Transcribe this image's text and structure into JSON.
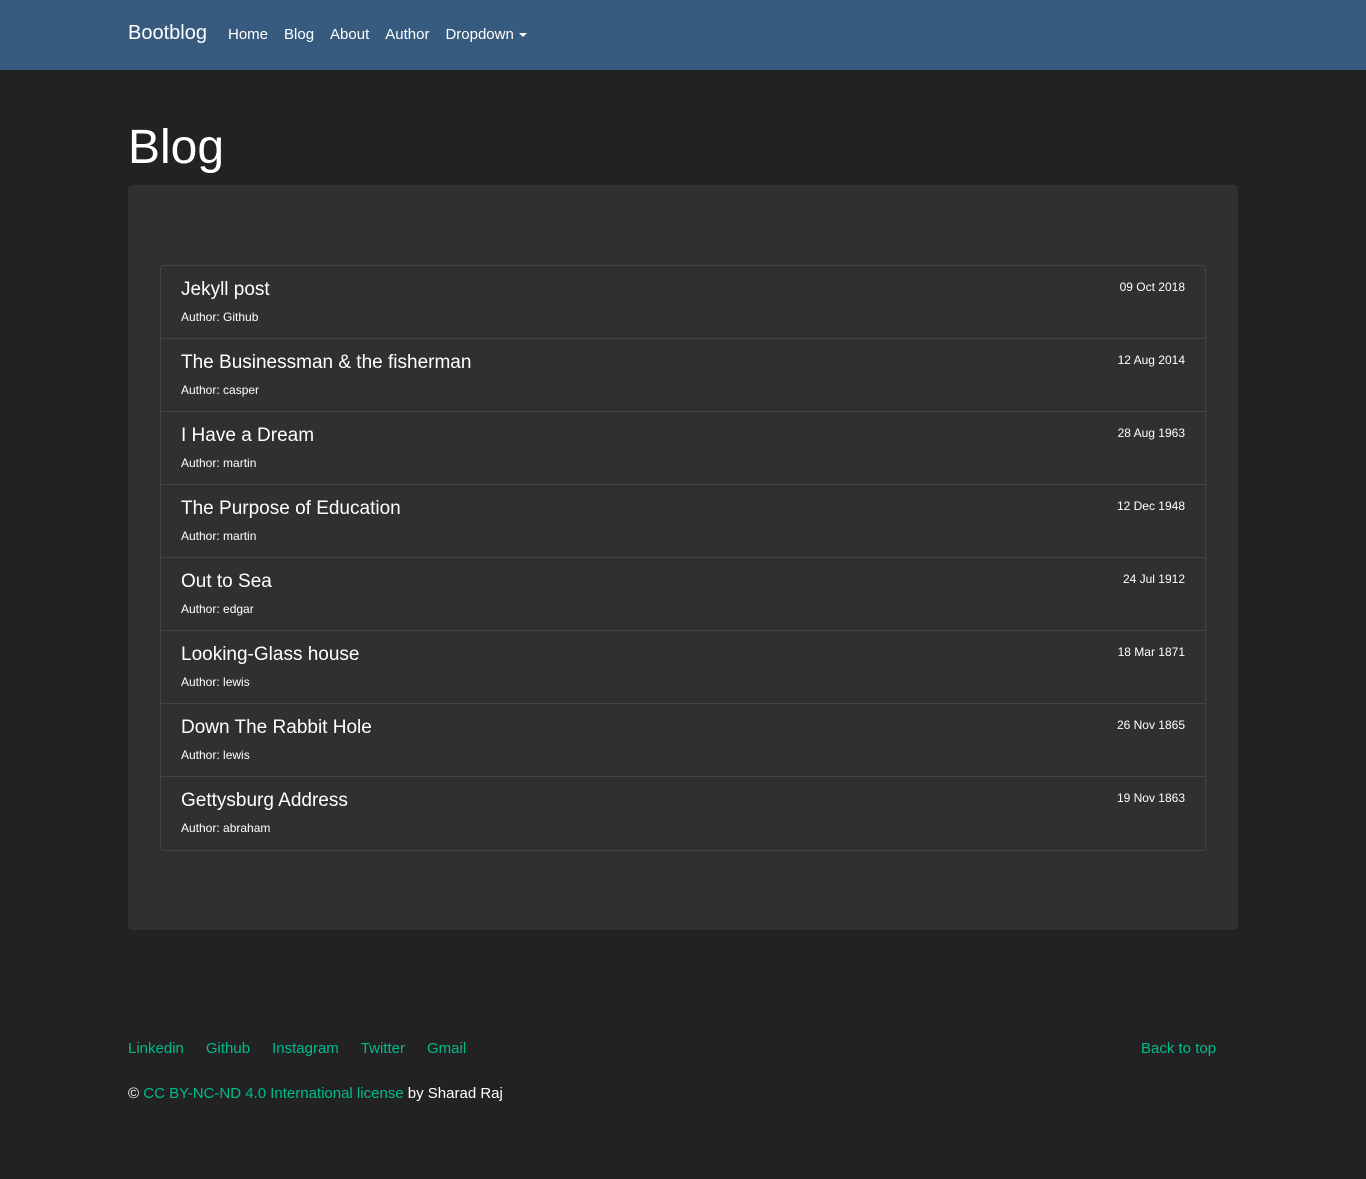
{
  "navbar": {
    "brand": "Bootblog",
    "links": [
      {
        "label": "Home"
      },
      {
        "label": "Blog"
      },
      {
        "label": "About"
      },
      {
        "label": "Author"
      },
      {
        "label": "Dropdown"
      }
    ],
    "background": "#375a7f"
  },
  "page": {
    "title": "Blog",
    "background": "#222222",
    "card_background": "#303030"
  },
  "posts": [
    {
      "title": "Jekyll post",
      "author": "Author: Github",
      "date": "09 Oct 2018"
    },
    {
      "title": "The Businessman & the fisherman",
      "author": "Author: casper",
      "date": "12 Aug 2014"
    },
    {
      "title": "I Have a Dream",
      "author": "Author: martin",
      "date": "28 Aug 1963"
    },
    {
      "title": "The Purpose of Education",
      "author": "Author: martin",
      "date": "12 Dec 1948"
    },
    {
      "title": "Out to Sea",
      "author": "Author: edgar",
      "date": "24 Jul 1912"
    },
    {
      "title": "Looking-Glass house",
      "author": "Author: lewis",
      "date": "18 Mar 1871"
    },
    {
      "title": "Down The Rabbit Hole",
      "author": "Author: lewis",
      "date": "26 Nov 1865"
    },
    {
      "title": "Gettysburg Address",
      "author": "Author: abraham",
      "date": "19 Nov 1863"
    }
  ],
  "footer": {
    "links": [
      {
        "label": "Linkedin"
      },
      {
        "label": "Github"
      },
      {
        "label": "Instagram"
      },
      {
        "label": "Twitter"
      },
      {
        "label": "Gmail"
      }
    ],
    "back_to_top": "Back to top",
    "copyright_symbol": "©",
    "license_link": "CC BY-NC-ND 4.0 International license",
    "byline": "by Sharad Raj",
    "link_color": "#00bc8c"
  }
}
